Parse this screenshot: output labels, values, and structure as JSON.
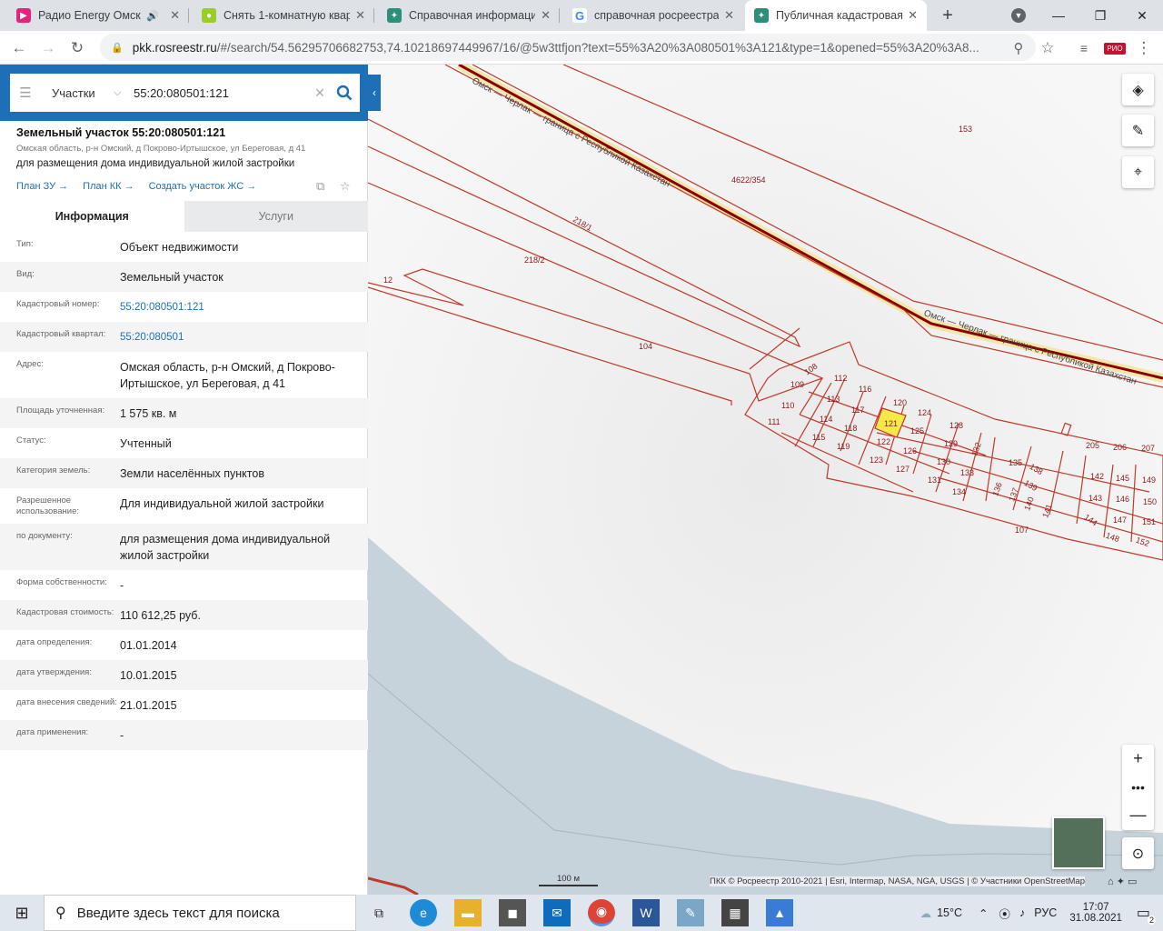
{
  "browser": {
    "tabs": [
      {
        "title": "Радио Energy Омск 8",
        "icon": "youtube-play-icon",
        "color": "#e3247e"
      },
      {
        "title": "Снять 1-комнатную квар",
        "icon": "avito-icon",
        "color": "#97cf26"
      },
      {
        "title": "Справочная информаци",
        "icon": "rosreestr-icon",
        "color": "#2d8f7a"
      },
      {
        "title": "справочная росреестра с",
        "icon": "google-icon",
        "color": "#4285f4"
      },
      {
        "title": "Публичная кадастровая",
        "icon": "rosreestr-icon",
        "color": "#2d8f7a"
      }
    ],
    "new_tab_label": "+",
    "url_host": "pkk.rosreestr.ru",
    "url_rest": "/#/search/54.56295706682753,74.10218697449967/16/@5w3ttfjon?text=55%3A20%3A080501%3A121&type=1&opened=55%3A20%3A8..."
  },
  "search": {
    "type_label": "Участки",
    "query": "55:20:080501:121"
  },
  "object": {
    "title": "Земельный участок 55:20:080501:121",
    "address": "Омская область, р-н Омский, д Покрово-Иртышское, ул Береговая, д 41",
    "purpose": "для размещения дома индивидуальной жилой застройки",
    "links": [
      "План ЗУ",
      "План КК",
      "Создать участок ЖС"
    ]
  },
  "tabs": {
    "info": "Информация",
    "services": "Услуги"
  },
  "rows": [
    {
      "k": "Тип:",
      "v": "Объект недвижимости"
    },
    {
      "k": "Вид:",
      "v": "Земельный участок"
    },
    {
      "k": "Кадастровый номер:",
      "v": "55:20:080501:121",
      "link": true
    },
    {
      "k": "Кадастровый квартал:",
      "v": "55:20:080501",
      "link": true
    },
    {
      "k": "Адрес:",
      "v": "Омская область, р-н Омский, д Покрово-Иртышское, ул Береговая, д 41"
    },
    {
      "k": "Площадь уточненная:",
      "v": "1 575 кв. м"
    },
    {
      "k": "Статус:",
      "v": "Учтенный"
    },
    {
      "k": "Категория земель:",
      "v": "Земли населённых пунктов"
    },
    {
      "k": "Разрешенное использование:",
      "v": "Для индивидуальной жилой застройки"
    },
    {
      "k": "по документу:",
      "v": "для размещения дома индивидуальной жилой застройки"
    },
    {
      "k": "Форма собственности:",
      "v": "-"
    },
    {
      "k": "Кадастровая стоимость:",
      "v": "110 612,25 руб."
    },
    {
      "k": "дата определения:",
      "v": "01.01.2014"
    },
    {
      "k": "дата утверждения:",
      "v": "10.01.2015"
    },
    {
      "k": "дата внесения сведений:",
      "v": "21.01.2015"
    },
    {
      "k": "дата применения:",
      "v": "-"
    }
  ],
  "map": {
    "labels": [
      "153",
      "4622/354",
      "218/1",
      "218/2",
      "12",
      "104",
      "108",
      "109",
      "110",
      "111",
      "112",
      "113",
      "114",
      "115",
      "116",
      "117",
      "118",
      "119",
      "120",
      "121",
      "122",
      "123",
      "124",
      "125",
      "126",
      "127",
      "128",
      "129",
      "130",
      "131",
      "132",
      "133",
      "134",
      "135",
      "136",
      "137",
      "138",
      "139",
      "140",
      "141",
      "142",
      "143",
      "144",
      "145",
      "146",
      "147",
      "148",
      "149",
      "150",
      "151",
      "152",
      "107",
      "205",
      "206",
      "207"
    ],
    "road_label_1": "Омск — Черлак — граница с Республикой Казахстан",
    "road_label_2": "Омск — Черлак — граница с Республикой Казахстан",
    "scale_label": "100 м",
    "attribution": "ПКК © Росреестр 2010-2021 | Esri, Intermap, NASA, NGA, USGS | © Участники OpenStreetMap",
    "highlight_parcel": "121"
  },
  "taskbar": {
    "search_placeholder": "Введите здесь текст для поиска",
    "weather": "15°C",
    "lang": "РУС",
    "time": "17:07",
    "date": "31.08.2021",
    "notif_count": "2"
  }
}
